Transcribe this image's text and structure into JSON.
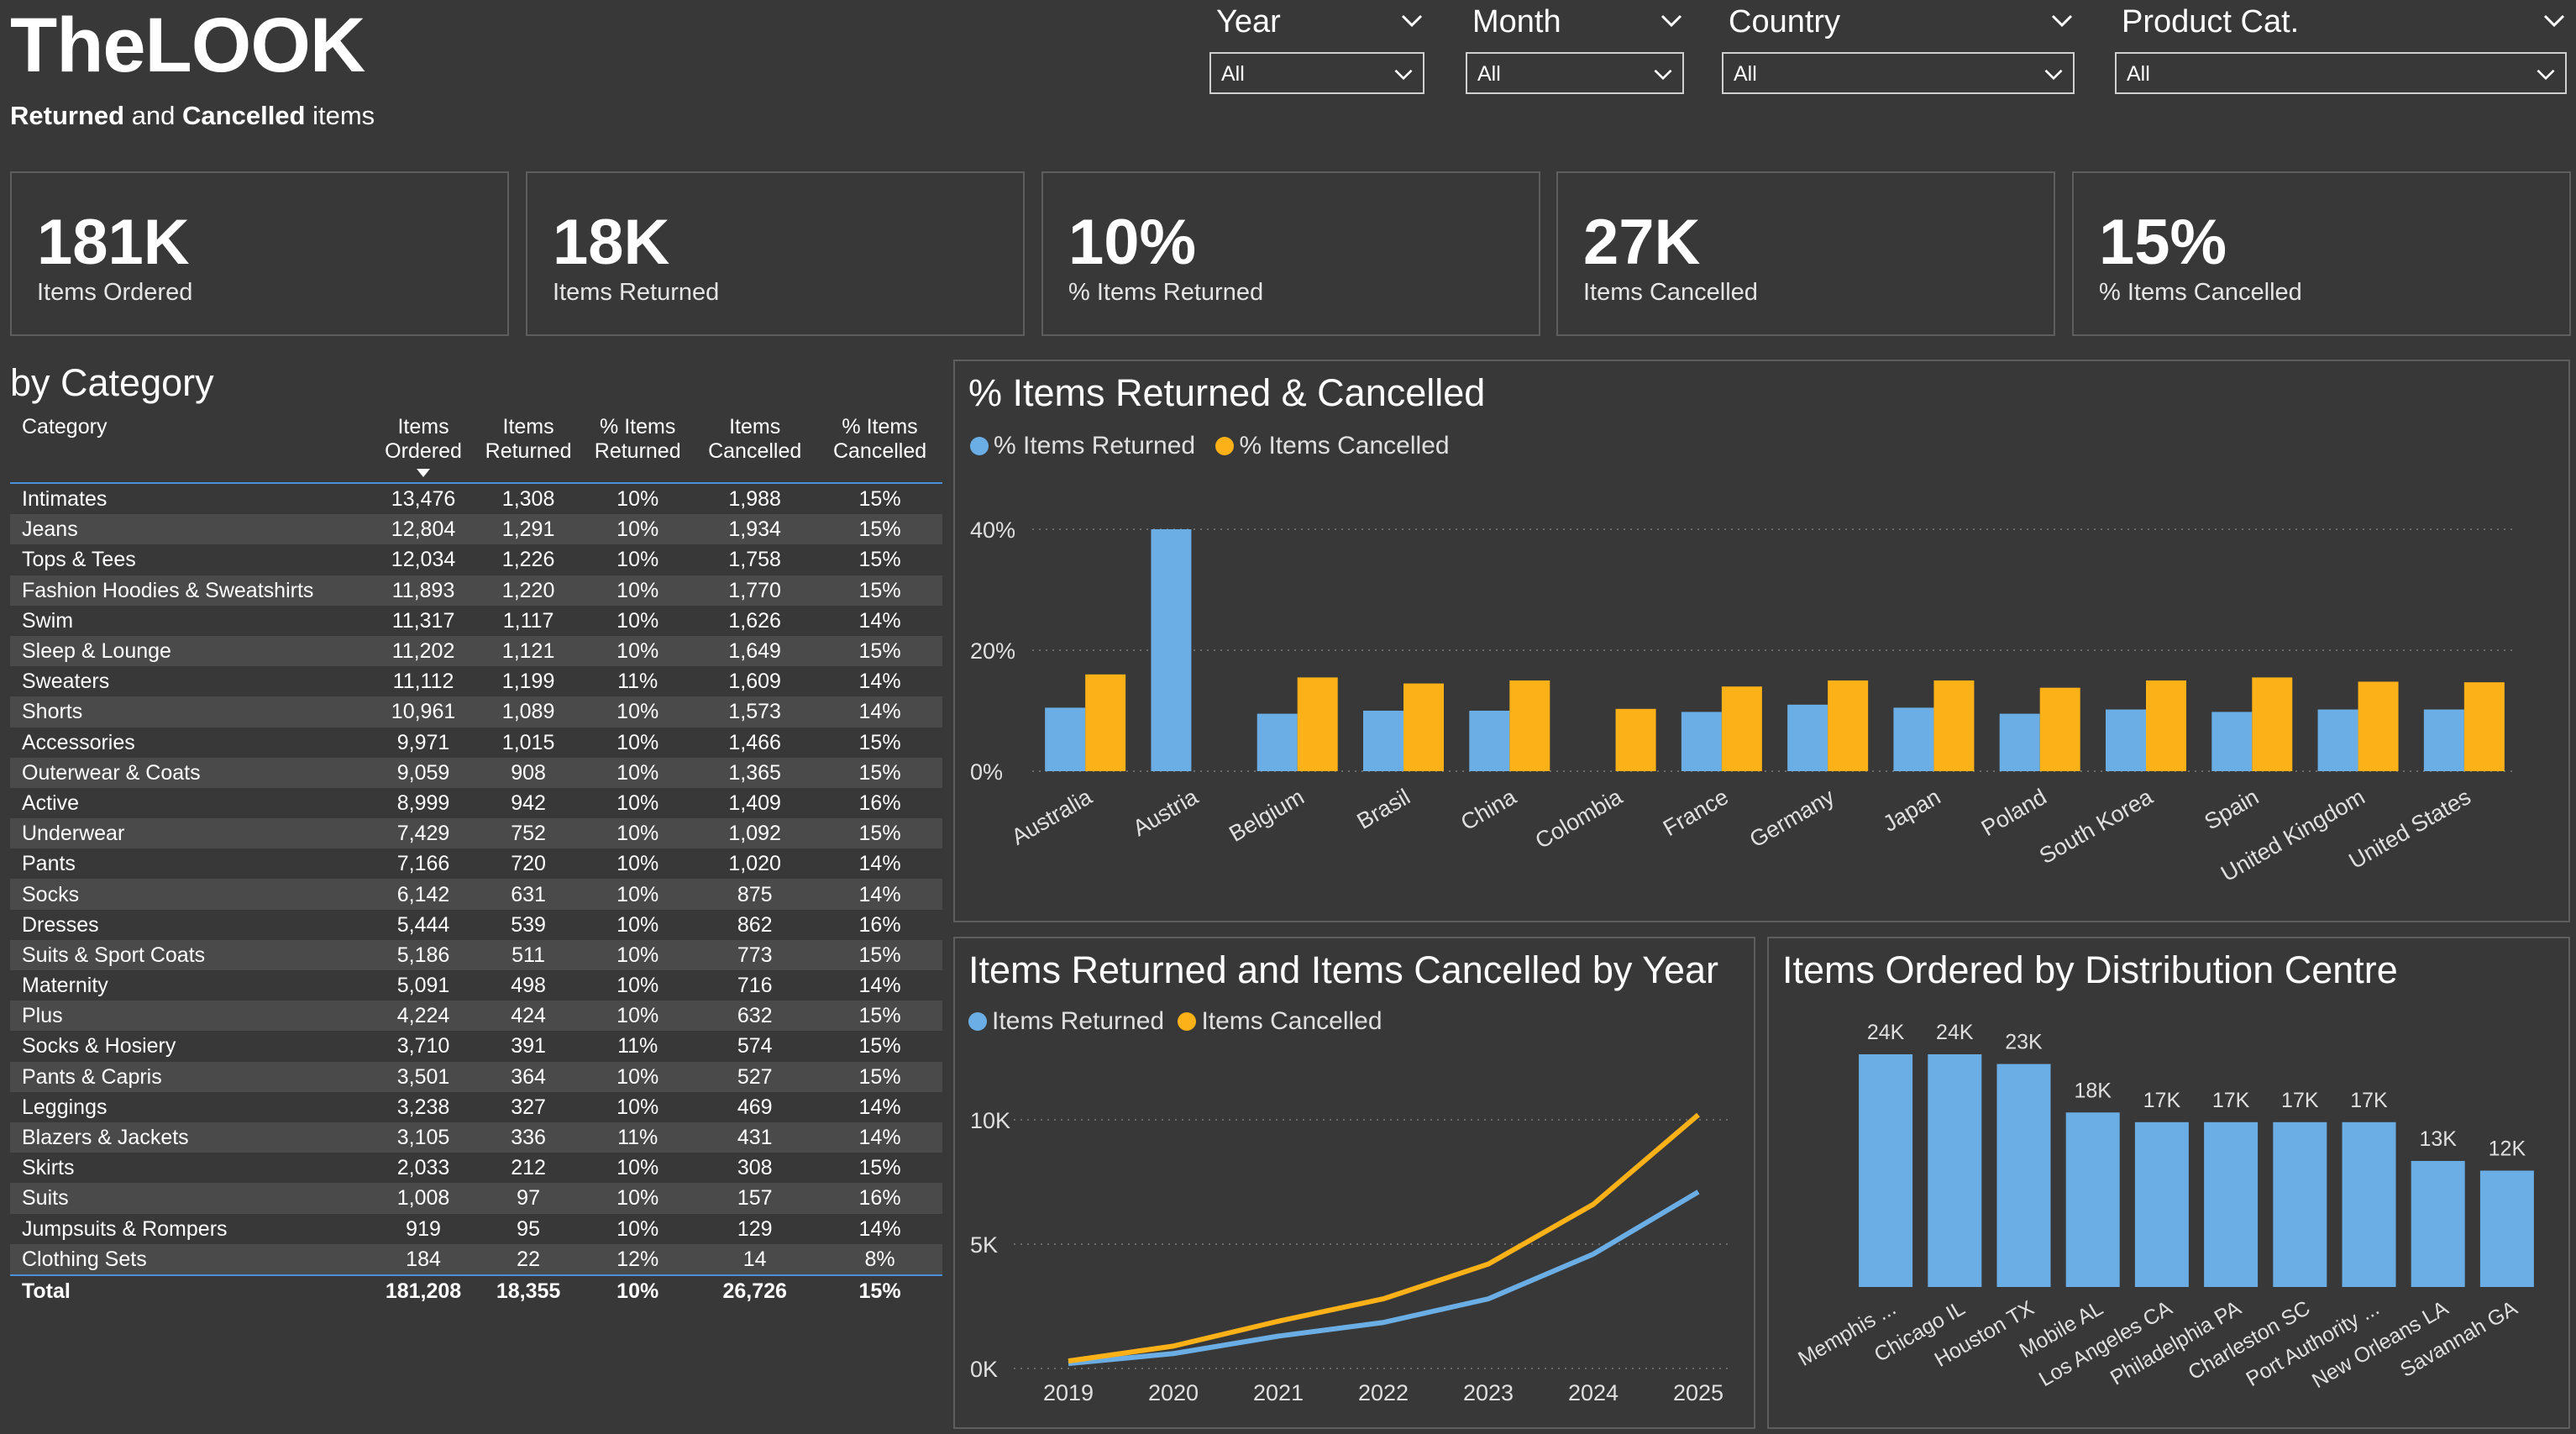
{
  "app": {
    "title": "TheLOOK",
    "subtitle_bold1": "Returned",
    "subtitle_mid": " and ",
    "subtitle_bold2": "Cancelled",
    "subtitle_end": " items"
  },
  "colors": {
    "returned": "#6aaee5",
    "cancelled": "#fbb117",
    "background": "#383838",
    "accent_line": "#4a90d9"
  },
  "filters": [
    {
      "label": "Year",
      "value": "All",
      "icon": "chevron-down-icon"
    },
    {
      "label": "Month",
      "value": "All",
      "icon": "chevron-down-icon"
    },
    {
      "label": "Country",
      "value": "All",
      "icon": "chevron-down-icon"
    },
    {
      "label": "Product Cat.",
      "value": "All",
      "icon": "chevron-down-icon"
    }
  ],
  "kpis": [
    {
      "value": "181K",
      "label": "Items Ordered"
    },
    {
      "value": "18K",
      "label": "Items Returned"
    },
    {
      "value": "10%",
      "label": "% Items Returned"
    },
    {
      "value": "27K",
      "label": "Items Cancelled"
    },
    {
      "value": "15%",
      "label": "% Items Cancelled"
    }
  ],
  "category_table": {
    "title": "by Category",
    "headers": {
      "category": "Category",
      "ordered_1": "Items",
      "ordered_2": "Ordered",
      "returned_1": "Items",
      "returned_2": "Returned",
      "pct_returned_1": "% Items",
      "pct_returned_2": "Returned",
      "cancelled_1": "Items",
      "cancelled_2": "Cancelled",
      "pct_cancelled_1": "% Items",
      "pct_cancelled_2": "Cancelled"
    },
    "rows": [
      [
        "Intimates",
        "13,476",
        "1,308",
        "10%",
        "1,988",
        "15%"
      ],
      [
        "Jeans",
        "12,804",
        "1,291",
        "10%",
        "1,934",
        "15%"
      ],
      [
        "Tops & Tees",
        "12,034",
        "1,226",
        "10%",
        "1,758",
        "15%"
      ],
      [
        "Fashion Hoodies & Sweatshirts",
        "11,893",
        "1,220",
        "10%",
        "1,770",
        "15%"
      ],
      [
        "Swim",
        "11,317",
        "1,117",
        "10%",
        "1,626",
        "14%"
      ],
      [
        "Sleep & Lounge",
        "11,202",
        "1,121",
        "10%",
        "1,649",
        "15%"
      ],
      [
        "Sweaters",
        "11,112",
        "1,199",
        "11%",
        "1,609",
        "14%"
      ],
      [
        "Shorts",
        "10,961",
        "1,089",
        "10%",
        "1,573",
        "14%"
      ],
      [
        "Accessories",
        "9,971",
        "1,015",
        "10%",
        "1,466",
        "15%"
      ],
      [
        "Outerwear & Coats",
        "9,059",
        "908",
        "10%",
        "1,365",
        "15%"
      ],
      [
        "Active",
        "8,999",
        "942",
        "10%",
        "1,409",
        "16%"
      ],
      [
        "Underwear",
        "7,429",
        "752",
        "10%",
        "1,092",
        "15%"
      ],
      [
        "Pants",
        "7,166",
        "720",
        "10%",
        "1,020",
        "14%"
      ],
      [
        "Socks",
        "6,142",
        "631",
        "10%",
        "875",
        "14%"
      ],
      [
        "Dresses",
        "5,444",
        "539",
        "10%",
        "862",
        "16%"
      ],
      [
        "Suits & Sport Coats",
        "5,186",
        "511",
        "10%",
        "773",
        "15%"
      ],
      [
        "Maternity",
        "5,091",
        "498",
        "10%",
        "716",
        "14%"
      ],
      [
        "Plus",
        "4,224",
        "424",
        "10%",
        "632",
        "15%"
      ],
      [
        "Socks & Hosiery",
        "3,710",
        "391",
        "11%",
        "574",
        "15%"
      ],
      [
        "Pants & Capris",
        "3,501",
        "364",
        "10%",
        "527",
        "15%"
      ],
      [
        "Leggings",
        "3,238",
        "327",
        "10%",
        "469",
        "14%"
      ],
      [
        "Blazers & Jackets",
        "3,105",
        "336",
        "11%",
        "431",
        "14%"
      ],
      [
        "Skirts",
        "2,033",
        "212",
        "10%",
        "308",
        "15%"
      ],
      [
        "Suits",
        "1,008",
        "97",
        "10%",
        "157",
        "16%"
      ],
      [
        "Jumpsuits & Rompers",
        "919",
        "95",
        "10%",
        "129",
        "14%"
      ],
      [
        "Clothing Sets",
        "184",
        "22",
        "12%",
        "14",
        "8%"
      ]
    ],
    "total": [
      "Total",
      "181,208",
      "18,355",
      "10%",
      "26,726",
      "15%"
    ]
  },
  "chart_data": [
    {
      "type": "bar",
      "title": "% Items Returned & Cancelled",
      "categories": [
        "Australia",
        "Austria",
        "Belgium",
        "Brasil",
        "China",
        "Colombia",
        "France",
        "Germany",
        "Japan",
        "Poland",
        "South Korea",
        "Spain",
        "United Kingdom",
        "United States"
      ],
      "series": [
        {
          "name": "% Items Returned",
          "values": [
            10.5,
            40,
            9.5,
            10,
            10,
            0,
            9.8,
            11,
            10.5,
            9.5,
            10.2,
            9.8,
            10.2,
            10.2
          ]
        },
        {
          "name": "% Items Cancelled",
          "values": [
            16,
            null,
            15.5,
            14.5,
            15,
            10.3,
            14,
            15,
            15,
            13.8,
            15,
            15.5,
            14.8,
            14.7
          ]
        }
      ],
      "yticks": [
        "0%",
        "20%",
        "40%"
      ],
      "ylim": [
        0,
        40
      ],
      "grid": true,
      "legend": "top-left"
    },
    {
      "type": "line",
      "title": "Items Returned and Items Cancelled by Year",
      "x": [
        "2019",
        "2020",
        "2021",
        "2022",
        "2023",
        "2024",
        "2025"
      ],
      "series": [
        {
          "name": "Items Returned",
          "values": [
            200,
            600,
            1300,
            1850,
            2800,
            4600,
            7100
          ]
        },
        {
          "name": "Items Cancelled",
          "values": [
            300,
            900,
            1900,
            2800,
            4200,
            6600,
            10200
          ]
        }
      ],
      "yticks": [
        "0K",
        "5K",
        "10K"
      ],
      "ylim": [
        0,
        10000
      ],
      "grid": true,
      "legend": "top-left"
    },
    {
      "type": "bar",
      "title": "Items Ordered by Distribution Centre",
      "categories": [
        "Memphis ...",
        "Chicago IL",
        "Houston TX",
        "Mobile AL",
        "Los Angeles CA",
        "Philadelphia PA",
        "Charleston SC",
        "Port Authority ...",
        "New Orleans LA",
        "Savannah GA"
      ],
      "values": [
        24,
        24,
        23,
        18,
        17,
        17,
        17,
        17,
        13,
        12
      ],
      "data_labels": [
        "24K",
        "24K",
        "23K",
        "18K",
        "17K",
        "17K",
        "17K",
        "17K",
        "13K",
        "12K"
      ],
      "ylim": [
        0,
        24
      ],
      "grid": false
    }
  ]
}
